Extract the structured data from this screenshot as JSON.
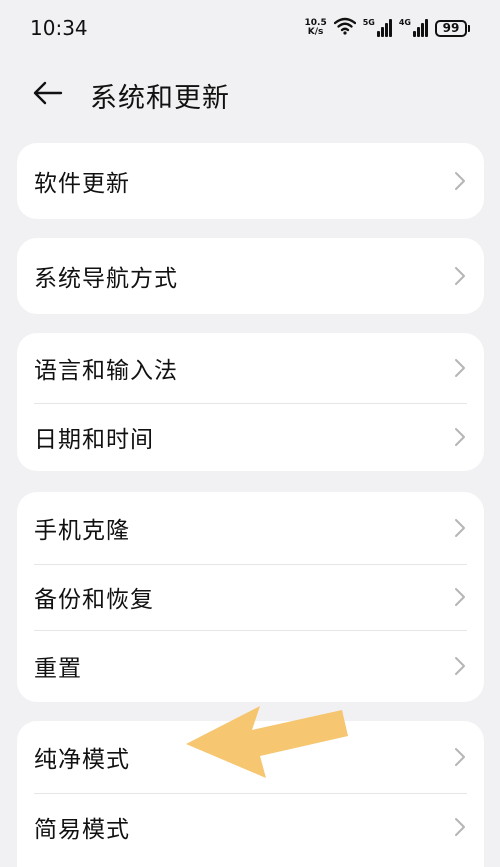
{
  "status_bar": {
    "time": "10:34",
    "net_speed_value": "10.5",
    "net_speed_unit": "K/s",
    "sim1_type": "5G",
    "sim2_type": "4G",
    "battery": "99",
    "icons": [
      "wifi-icon",
      "signal-5g-icon",
      "signal-4g-icon",
      "battery-icon"
    ]
  },
  "header": {
    "back_icon": "arrow-left-icon",
    "title": "系统和更新"
  },
  "groups": [
    {
      "items": [
        {
          "label": "软件更新"
        }
      ]
    },
    {
      "items": [
        {
          "label": "系统导航方式"
        }
      ]
    },
    {
      "items": [
        {
          "label": "语言和输入法"
        },
        {
          "label": "日期和时间"
        }
      ]
    },
    {
      "items": [
        {
          "label": "手机克隆"
        },
        {
          "label": "备份和恢复"
        },
        {
          "label": "重置"
        }
      ]
    },
    {
      "items": [
        {
          "label": "纯净模式"
        },
        {
          "label": "简易模式"
        }
      ]
    }
  ],
  "annotation": {
    "arrow_color": "#f5c060",
    "points_to": "纯净模式"
  },
  "colors": {
    "background": "#f1f1f3",
    "card": "#ffffff",
    "chevron": "#b5b5b8"
  }
}
